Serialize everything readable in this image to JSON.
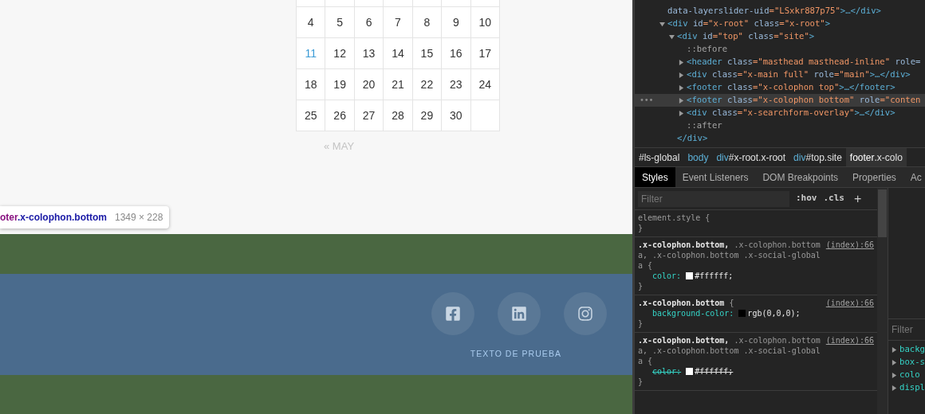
{
  "calendar": {
    "weeks": [
      [
        {
          "kind": "blank"
        },
        {
          "kind": "blank"
        },
        {
          "kind": "blank"
        },
        {
          "kind": "blank"
        },
        {
          "kind": "blank"
        },
        {
          "kind": "blank"
        },
        {
          "kind": "blank"
        }
      ],
      [
        {
          "day": "4",
          "linked": false
        },
        {
          "day": "5",
          "linked": false
        },
        {
          "day": "6",
          "linked": false
        },
        {
          "day": "7",
          "linked": false
        },
        {
          "day": "8",
          "linked": false
        },
        {
          "day": "9",
          "linked": false
        },
        {
          "day": "10",
          "linked": false
        }
      ],
      [
        {
          "day": "11",
          "linked": true
        },
        {
          "day": "12",
          "linked": false
        },
        {
          "day": "13",
          "linked": false
        },
        {
          "day": "14",
          "linked": false
        },
        {
          "day": "15",
          "linked": false
        },
        {
          "day": "16",
          "linked": false
        },
        {
          "day": "17",
          "linked": false
        }
      ],
      [
        {
          "day": "18",
          "linked": false
        },
        {
          "day": "19",
          "linked": false
        },
        {
          "day": "20",
          "linked": false
        },
        {
          "day": "21",
          "linked": false
        },
        {
          "day": "22",
          "linked": false
        },
        {
          "day": "23",
          "linked": false
        },
        {
          "day": "24",
          "linked": false
        }
      ],
      [
        {
          "day": "25",
          "linked": false
        },
        {
          "day": "26",
          "linked": false
        },
        {
          "day": "27",
          "linked": false
        },
        {
          "day": "28",
          "linked": false
        },
        {
          "day": "29",
          "linked": false
        },
        {
          "day": "30",
          "linked": false
        },
        {
          "kind": "blank"
        }
      ]
    ],
    "prev_link": "« MAY"
  },
  "inspect_tooltip": {
    "tag": "oter",
    "classes": ".x-colophon.bottom",
    "size": "1349 × 228"
  },
  "footer": {
    "social": [
      {
        "kind": "facebook"
      },
      {
        "kind": "linkedin"
      },
      {
        "kind": "instagram"
      }
    ],
    "text": "TEXTO DE PRUEBA"
  },
  "elements_tree": [
    {
      "kind": "leaf",
      "selected": false,
      "tokens": [
        {
          "kind": "attr",
          "text": "data-layerslider-uid"
        },
        {
          "kind": "value",
          "text": "=\"LSxkr887p75\""
        },
        {
          "kind": "tag",
          "text": ">…</div>"
        }
      ]
    },
    {
      "kind": "parent",
      "expanded": true,
      "selected": false,
      "tokens": [
        {
          "kind": "tag",
          "text": "<div "
        },
        {
          "kind": "attr",
          "text": "id"
        },
        {
          "kind": "value",
          "text": "=\"x-root\" "
        },
        {
          "kind": "attr",
          "text": "class"
        },
        {
          "kind": "value",
          "text": "=\"x-root\""
        },
        {
          "kind": "tag",
          "text": ">"
        }
      ],
      "children": [
        {
          "kind": "parent",
          "expanded": true,
          "selected": false,
          "close": "</div>",
          "tokens": [
            {
              "kind": "tag",
              "text": "<div "
            },
            {
              "kind": "attr",
              "text": "id"
            },
            {
              "kind": "value",
              "text": "=\"top\" "
            },
            {
              "kind": "attr",
              "text": "class"
            },
            {
              "kind": "value",
              "text": "=\"site\""
            },
            {
              "kind": "tag",
              "text": ">"
            }
          ],
          "children": [
            {
              "kind": "leaf",
              "selected": false,
              "tokens": [
                {
                  "kind": "pseudo",
                  "text": "::before"
                }
              ]
            },
            {
              "kind": "parent",
              "expanded": false,
              "selected": false,
              "tokens": [
                {
                  "kind": "tag",
                  "text": "<header "
                },
                {
                  "kind": "attr",
                  "text": "class"
                },
                {
                  "kind": "value",
                  "text": "=\"masthead masthead-inline\" "
                },
                {
                  "kind": "attr",
                  "text": "role="
                }
              ]
            },
            {
              "kind": "parent",
              "expanded": false,
              "selected": false,
              "tokens": [
                {
                  "kind": "tag",
                  "text": "<div "
                },
                {
                  "kind": "attr",
                  "text": "class"
                },
                {
                  "kind": "value",
                  "text": "=\"x-main full\" "
                },
                {
                  "kind": "attr",
                  "text": "role"
                },
                {
                  "kind": "value",
                  "text": "=\"main\""
                },
                {
                  "kind": "tag",
                  "text": ">…</div>"
                }
              ]
            },
            {
              "kind": "parent",
              "expanded": false,
              "selected": false,
              "tokens": [
                {
                  "kind": "tag",
                  "text": "<footer "
                },
                {
                  "kind": "attr",
                  "text": "class"
                },
                {
                  "kind": "value",
                  "text": "=\"x-colophon top\""
                },
                {
                  "kind": "tag",
                  "text": ">…</footer>"
                }
              ]
            },
            {
              "kind": "parent",
              "expanded": false,
              "selected": true,
              "menu": "•••",
              "tokens": [
                {
                  "kind": "tag",
                  "text": "<footer "
                },
                {
                  "kind": "attr",
                  "text": "class"
                },
                {
                  "kind": "value",
                  "text": "=\"x-colophon bottom\" "
                },
                {
                  "kind": "attr",
                  "text": "role"
                },
                {
                  "kind": "value",
                  "text": "=\"conten"
                }
              ]
            },
            {
              "kind": "parent",
              "expanded": false,
              "selected": false,
              "tokens": [
                {
                  "kind": "tag",
                  "text": "<div "
                },
                {
                  "kind": "attr",
                  "text": "class"
                },
                {
                  "kind": "value",
                  "text": "=\"x-searchform-overlay\""
                },
                {
                  "kind": "tag",
                  "text": ">…</div>"
                }
              ]
            },
            {
              "kind": "leaf",
              "selected": false,
              "tokens": [
                {
                  "kind": "pseudo",
                  "text": "::after"
                }
              ]
            }
          ]
        }
      ]
    }
  ],
  "breadcrumbs": [
    {
      "rest": "#ls-global",
      "selected": false
    },
    {
      "tag": "body",
      "selected": false
    },
    {
      "tag": "div",
      "rest": "#x-root.x-root",
      "selected": false
    },
    {
      "tag": "div",
      "rest": "#top.site",
      "selected": false
    },
    {
      "tag": "footer",
      "rest": ".x-colo",
      "selected": true
    }
  ],
  "tabs": [
    {
      "label": "Styles",
      "selected": true
    },
    {
      "label": "Event Listeners",
      "selected": false
    },
    {
      "label": "DOM Breakpoints",
      "selected": false
    },
    {
      "label": "Properties",
      "selected": false
    },
    {
      "label": "Ac",
      "selected": false
    }
  ],
  "styles_toolbar": {
    "placeholder": "Filter",
    "hov": ":hov",
    "cls": ".cls",
    "add": "+"
  },
  "rules": [
    {
      "rest": "element.style {",
      "close": "}"
    },
    {
      "match": ".x-colophon.bottom,",
      "rest": " .x-colophon.bottom a, .x-colophon.bottom .x-social-global a {",
      "source": "(index):66",
      "declarations": [
        {
          "property": "color:",
          "value": "#ffffff;",
          "color": "#ffffff",
          "overridden": false
        }
      ],
      "close": "}"
    },
    {
      "match": ".x-colophon.bottom",
      "rest": " {",
      "source": "(index):66",
      "declarations": [
        {
          "property": "background-color:",
          "value": "rgb(0,0,0);",
          "color": "#000000",
          "overridden": false
        }
      ],
      "close": "}"
    },
    {
      "match": ".x-colophon.bottom,",
      "rest": " .x-colophon.bottom a, .x-colophon.bottom .x-social-global a {",
      "source": "(index):66",
      "declarations": [
        {
          "property": "color:",
          "value": "#ffffff;",
          "color": "#ffffff",
          "overridden": true
        }
      ],
      "close": "}"
    }
  ],
  "computed": {
    "placeholder": "Filter",
    "properties": [
      "backg",
      "box-s",
      "colo",
      "displ"
    ]
  }
}
